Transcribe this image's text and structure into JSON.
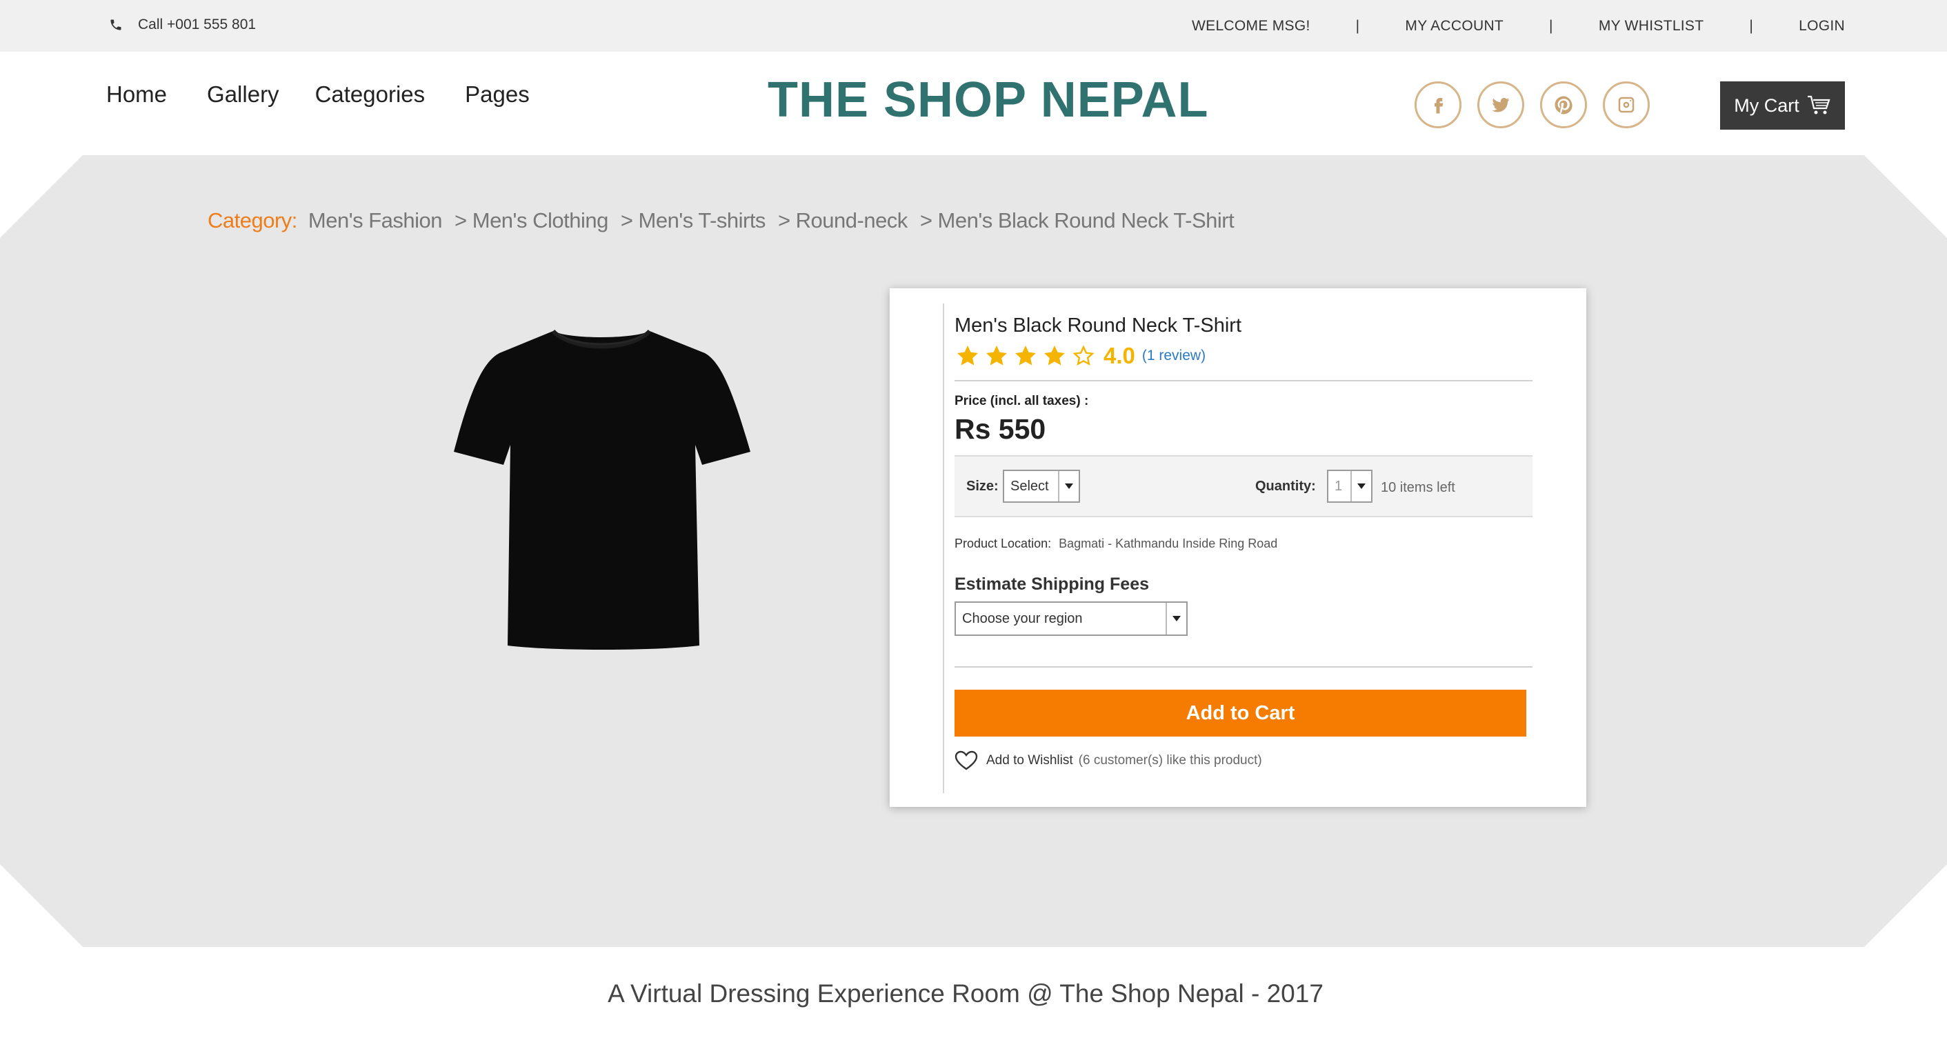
{
  "topbar": {
    "phone": "Call +001 555 801",
    "links": [
      "WELCOME MSG!",
      "MY ACCOUNT",
      "MY WHISTLIST",
      "LOGIN"
    ],
    "separator": "|"
  },
  "nav": {
    "items": [
      "Home",
      "Gallery",
      "Categories",
      "Pages"
    ]
  },
  "brand": {
    "logo": "THE SHOP NEPAL",
    "color": "#2f7270"
  },
  "social": {
    "icons": [
      "facebook-icon",
      "twitter-icon",
      "pinterest-icon",
      "instagram-icon"
    ],
    "color": "#c9a472"
  },
  "cart": {
    "label": "My Cart"
  },
  "breadcrumb": {
    "label": "Category:",
    "items": [
      "Men's Fashion",
      "> Men's Clothing",
      "> Men's T-shirts",
      "> Round-neck",
      "> Men's Black Round Neck T-Shirt"
    ]
  },
  "product": {
    "title": "Men's Black Round Neck T-Shirt",
    "rating": 4.0,
    "rating_text": "4.0",
    "max_rating": 5,
    "reviews": "(1 review)",
    "price_label": "Price (incl. all taxes) :",
    "price": "Rs 550",
    "size_label": "Size:",
    "size_value": "Select",
    "quantity_label": "Quantity:",
    "quantity_value": "1",
    "items_left": "10 items left",
    "location_label": "Product Location:",
    "location_value": "Bagmati - Kathmandu Inside Ring Road",
    "shipping_title": "Estimate Shipping Fees",
    "region_placeholder": "Choose your region",
    "add_to_cart": "Add to Cart",
    "wishlist_label": "Add to Wishlist",
    "wishlist_likes": "(6 customer(s) like this product)"
  },
  "colors": {
    "accent": "#f57c00",
    "star": "#f5b400",
    "breadcrumb_label": "#ef7d1a"
  },
  "footer": {
    "text": "A Virtual Dressing Experience Room @ The Shop Nepal - 2017"
  }
}
